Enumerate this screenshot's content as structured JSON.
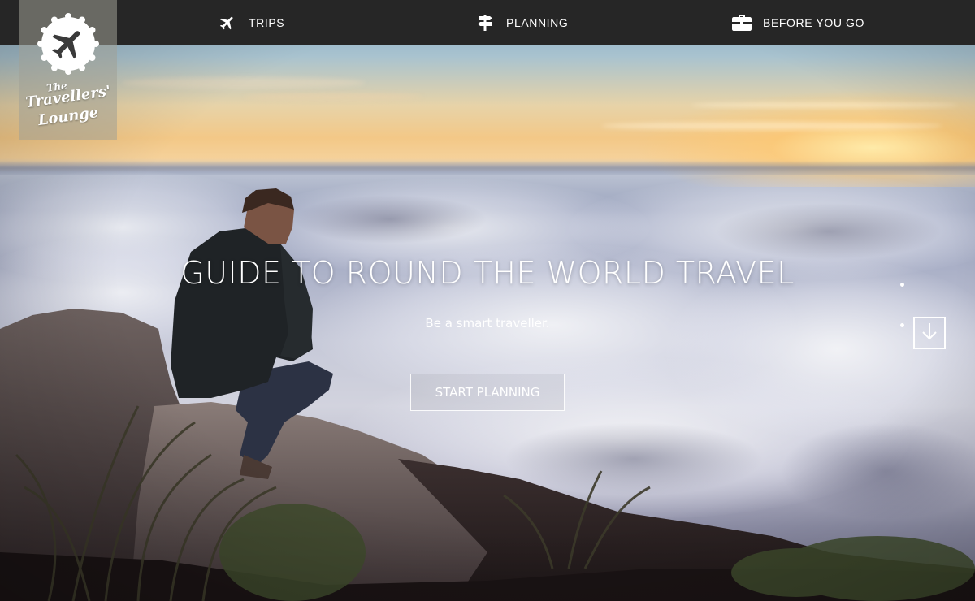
{
  "logo": {
    "line1": "The",
    "line2": "Travellers'",
    "line3": "Lounge",
    "icon": "airplane-icon"
  },
  "nav": {
    "items": [
      {
        "label": "TRIPS",
        "icon": "airplane-icon"
      },
      {
        "label": "PLANNING",
        "icon": "signpost-icon"
      },
      {
        "label": "BEFORE YOU GO",
        "icon": "briefcase-icon"
      }
    ]
  },
  "hero": {
    "title": "GUIDE TO ROUND THE WORLD TRAVEL",
    "subtitle": "Be a smart traveller.",
    "cta_label": "START PLANNING",
    "scroll_icon": "arrow-down-icon",
    "pagination_dots": 2
  },
  "colors": {
    "navbar_bg": "#262626",
    "text": "#ffffff",
    "logo_bg": "#a0a096"
  }
}
